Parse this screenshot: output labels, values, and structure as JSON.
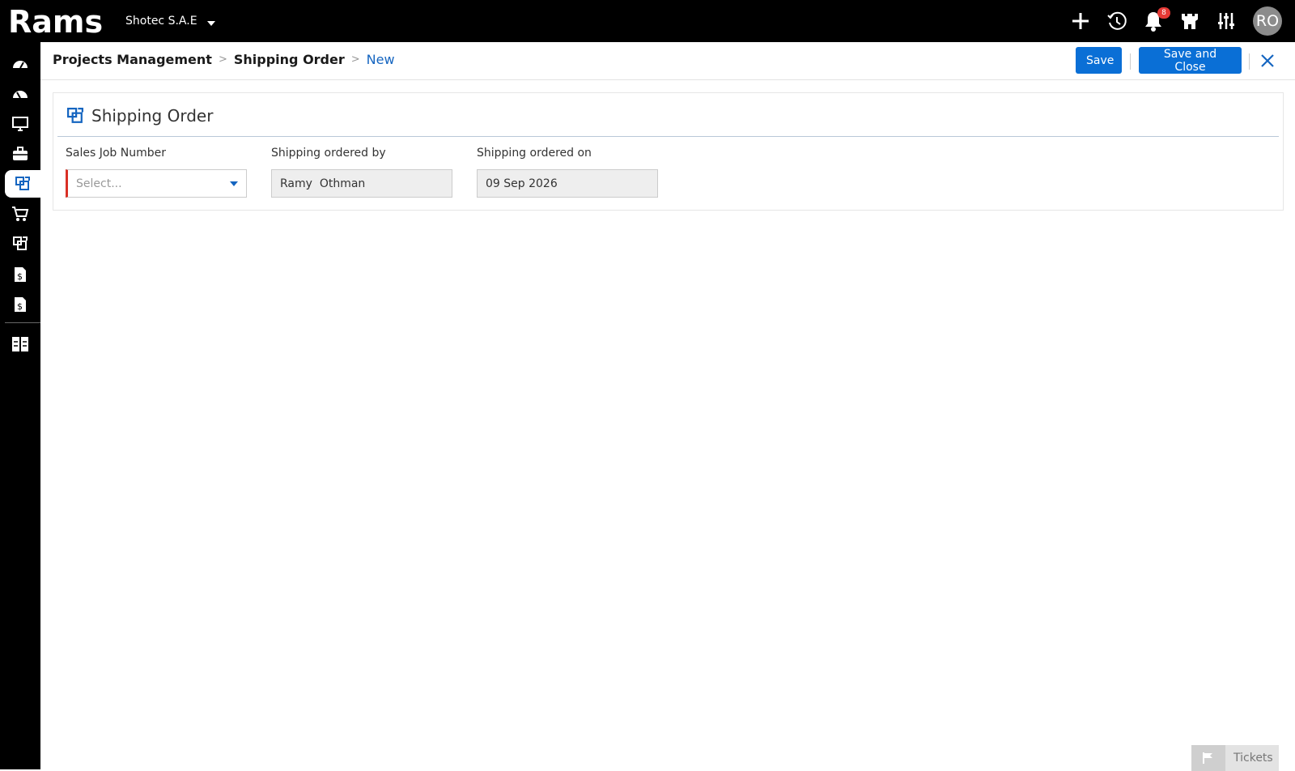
{
  "app": {
    "logo_text": "Rams",
    "company": "Shotec S.A.E"
  },
  "topbar": {
    "notification_count": "8",
    "user_initials": "RO",
    "icons": [
      "plus-icon",
      "history-icon",
      "bell-icon",
      "castle-icon",
      "sliders-icon"
    ]
  },
  "sidebar": {
    "items": [
      {
        "icon": "dashboard-icon"
      },
      {
        "icon": "dashboard-alt-icon"
      },
      {
        "icon": "monitor-icon"
      },
      {
        "icon": "briefcase-icon"
      },
      {
        "icon": "shipping-order-icon",
        "active": true
      },
      {
        "icon": "cart-icon"
      },
      {
        "icon": "shipping-order-alt-icon"
      },
      {
        "icon": "invoice-icon"
      },
      {
        "icon": "invoice-alt-icon"
      },
      {
        "icon": "layout-icon"
      }
    ]
  },
  "breadcrumb": {
    "items": [
      "Projects Management",
      "Shipping Order"
    ],
    "current": "New"
  },
  "actions": {
    "save_label": "Save",
    "save_close_label": "Save and Close"
  },
  "form": {
    "title": "Shipping Order",
    "fields": {
      "sales_job_number": {
        "label": "Sales Job Number",
        "placeholder": "Select..."
      },
      "shipping_ordered_by": {
        "label": "Shipping ordered by",
        "value": "Ramy  Othman"
      },
      "shipping_ordered_on": {
        "label": "Shipping ordered on",
        "value": "09 Sep 2026"
      }
    }
  },
  "tickets": {
    "label": "Tickets"
  },
  "colors": {
    "accent": "#0a6fd6",
    "topbar": "#000000",
    "required": "#d93025",
    "badge": "#e53935"
  }
}
